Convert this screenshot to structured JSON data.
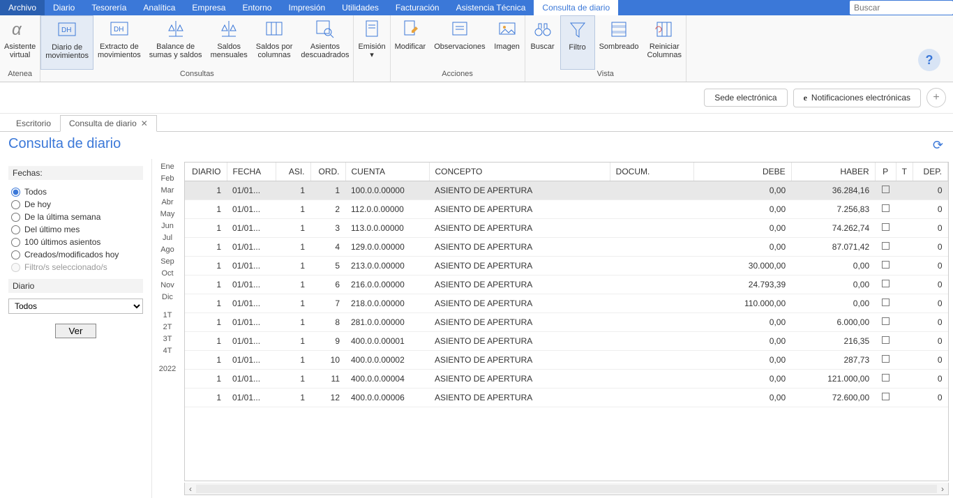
{
  "menu": [
    "Archivo",
    "Diario",
    "Tesorería",
    "Analítica",
    "Empresa",
    "Entorno",
    "Impresión",
    "Utilidades",
    "Facturación",
    "Asistencia Técnica",
    "Consulta de diario"
  ],
  "menu_active_index": 10,
  "search_placeholder": "Buscar",
  "ribbon": {
    "groups": [
      {
        "title": "Atenea",
        "buttons": [
          {
            "label": "Asistente\nvirtual",
            "icon": "alpha"
          }
        ]
      },
      {
        "title": "Consultas",
        "buttons": [
          {
            "label": "Diario de\nmovimientos",
            "icon": "dh",
            "active": true
          },
          {
            "label": "Extracto de\nmovimientos",
            "icon": "dh2"
          },
          {
            "label": "Balance de\nsumas y saldos",
            "icon": "scale"
          },
          {
            "label": "Saldos\nmensuales",
            "icon": "scale2"
          },
          {
            "label": "Saldos por\ncolumnas",
            "icon": "cols"
          },
          {
            "label": "Asientos\ndescuadrados",
            "icon": "magnify"
          }
        ]
      },
      {
        "title": "",
        "buttons": [
          {
            "label": "Emisión\n▾",
            "icon": "doc"
          }
        ]
      },
      {
        "title": "Acciones",
        "buttons": [
          {
            "label": "Modificar",
            "icon": "edit"
          },
          {
            "label": "Observaciones",
            "icon": "note"
          },
          {
            "label": "Imagen",
            "icon": "image"
          }
        ]
      },
      {
        "title": "Vista",
        "buttons": [
          {
            "label": "Buscar",
            "icon": "binoc"
          },
          {
            "label": "Filtro",
            "icon": "funnel",
            "active": true
          },
          {
            "label": "Sombreado",
            "icon": "shade"
          },
          {
            "label": "Reiniciar\nColumnas",
            "icon": "reset"
          }
        ]
      }
    ]
  },
  "subheader": {
    "sede": "Sede electrónica",
    "notif": "Notificaciones electrónicas"
  },
  "tabs": [
    {
      "label": "Escritorio",
      "closable": false,
      "active": false
    },
    {
      "label": "Consulta de diario",
      "closable": true,
      "active": true
    }
  ],
  "page_title": "Consulta de diario",
  "sidebar": {
    "fechas_label": "Fechas:",
    "radios": [
      "Todos",
      "De hoy",
      "De la última semana",
      "Del último mes",
      "100 últimos asientos",
      "Creados/modificados hoy"
    ],
    "radio_checked_index": 0,
    "filtro_sel": "Filtro/s seleccionado/s",
    "diario_label": "Diario",
    "diario_value": "Todos",
    "ver": "Ver"
  },
  "months": [
    "Ene",
    "Feb",
    "Mar",
    "Abr",
    "May",
    "Jun",
    "Jul",
    "Ago",
    "Sep",
    "Oct",
    "Nov",
    "Dic",
    "",
    "1T",
    "2T",
    "3T",
    "4T",
    "",
    "2022"
  ],
  "grid": {
    "headers": [
      "DIARIO",
      "FECHA",
      "ASI.",
      "ORD.",
      "CUENTA",
      "CONCEPTO",
      "DOCUM.",
      "DEBE",
      "HABER",
      "P",
      "T",
      "DEP."
    ],
    "rows": [
      {
        "diario": "1",
        "fecha": "01/01...",
        "asi": "1",
        "ord": "1",
        "cuenta": "100.0.0.00000",
        "concepto": "ASIENTO DE APERTURA",
        "docum": "",
        "debe": "0,00",
        "haber": "36.284,16",
        "p": false,
        "dep": "0",
        "selected": true
      },
      {
        "diario": "1",
        "fecha": "01/01...",
        "asi": "1",
        "ord": "2",
        "cuenta": "112.0.0.00000",
        "concepto": "ASIENTO DE APERTURA",
        "docum": "",
        "debe": "0,00",
        "haber": "7.256,83",
        "p": false,
        "dep": "0"
      },
      {
        "diario": "1",
        "fecha": "01/01...",
        "asi": "1",
        "ord": "3",
        "cuenta": "113.0.0.00000",
        "concepto": "ASIENTO DE APERTURA",
        "docum": "",
        "debe": "0,00",
        "haber": "74.262,74",
        "p": false,
        "dep": "0"
      },
      {
        "diario": "1",
        "fecha": "01/01...",
        "asi": "1",
        "ord": "4",
        "cuenta": "129.0.0.00000",
        "concepto": "ASIENTO DE APERTURA",
        "docum": "",
        "debe": "0,00",
        "haber": "87.071,42",
        "p": false,
        "dep": "0"
      },
      {
        "diario": "1",
        "fecha": "01/01...",
        "asi": "1",
        "ord": "5",
        "cuenta": "213.0.0.00000",
        "concepto": "ASIENTO DE APERTURA",
        "docum": "",
        "debe": "30.000,00",
        "haber": "0,00",
        "p": false,
        "dep": "0"
      },
      {
        "diario": "1",
        "fecha": "01/01...",
        "asi": "1",
        "ord": "6",
        "cuenta": "216.0.0.00000",
        "concepto": "ASIENTO DE APERTURA",
        "docum": "",
        "debe": "24.793,39",
        "haber": "0,00",
        "p": false,
        "dep": "0"
      },
      {
        "diario": "1",
        "fecha": "01/01...",
        "asi": "1",
        "ord": "7",
        "cuenta": "218.0.0.00000",
        "concepto": "ASIENTO DE APERTURA",
        "docum": "",
        "debe": "110.000,00",
        "haber": "0,00",
        "p": false,
        "dep": "0"
      },
      {
        "diario": "1",
        "fecha": "01/01...",
        "asi": "1",
        "ord": "8",
        "cuenta": "281.0.0.00000",
        "concepto": "ASIENTO DE APERTURA",
        "docum": "",
        "debe": "0,00",
        "haber": "6.000,00",
        "p": false,
        "dep": "0"
      },
      {
        "diario": "1",
        "fecha": "01/01...",
        "asi": "1",
        "ord": "9",
        "cuenta": "400.0.0.00001",
        "concepto": "ASIENTO DE APERTURA",
        "docum": "",
        "debe": "0,00",
        "haber": "216,35",
        "p": false,
        "dep": "0"
      },
      {
        "diario": "1",
        "fecha": "01/01...",
        "asi": "1",
        "ord": "10",
        "cuenta": "400.0.0.00002",
        "concepto": "ASIENTO DE APERTURA",
        "docum": "",
        "debe": "0,00",
        "haber": "287,73",
        "p": false,
        "dep": "0"
      },
      {
        "diario": "1",
        "fecha": "01/01...",
        "asi": "1",
        "ord": "11",
        "cuenta": "400.0.0.00004",
        "concepto": "ASIENTO DE APERTURA",
        "docum": "",
        "debe": "0,00",
        "haber": "121.000,00",
        "p": false,
        "dep": "0"
      },
      {
        "diario": "1",
        "fecha": "01/01...",
        "asi": "1",
        "ord": "12",
        "cuenta": "400.0.0.00006",
        "concepto": "ASIENTO DE APERTURA",
        "docum": "",
        "debe": "0,00",
        "haber": "72.600,00",
        "p": false,
        "dep": "0"
      }
    ]
  }
}
